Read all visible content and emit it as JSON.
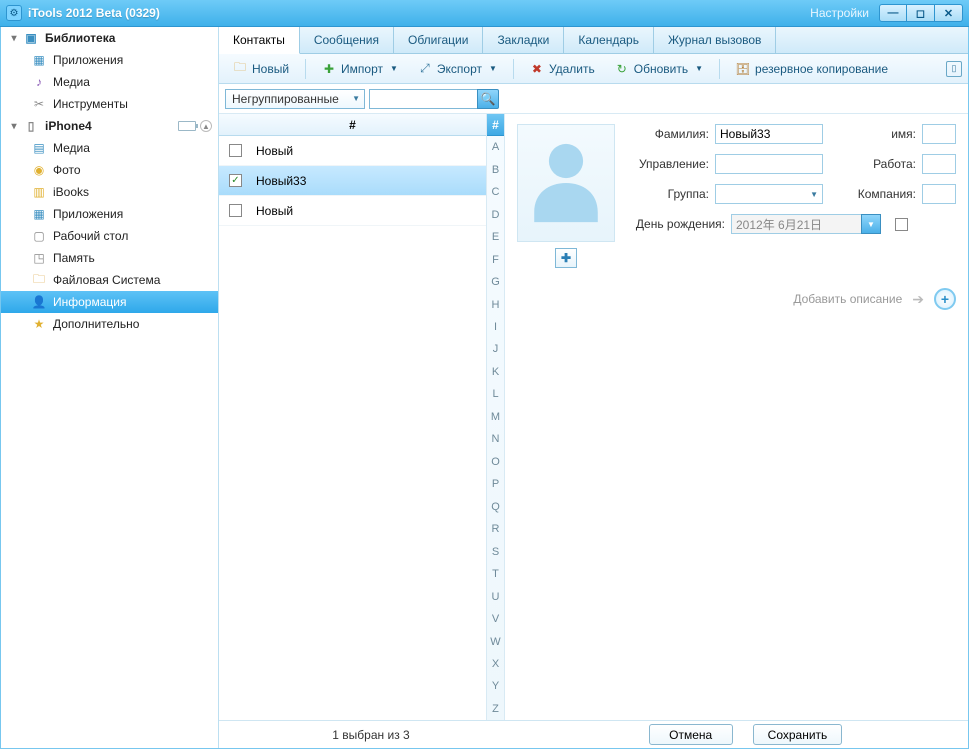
{
  "window": {
    "title": "iTools 2012 Beta (0329)",
    "settings": "Настройки"
  },
  "sidebar": {
    "library": "Библиотека",
    "lib_items": [
      "Приложения",
      "Медиа",
      "Инструменты"
    ],
    "device": "iPhone4",
    "dev_items": [
      "Медиа",
      "Фото",
      "iBooks",
      "Приложения",
      "Рабочий стол",
      "Память",
      "Файловая Система",
      "Информация",
      "Дополнительно"
    ],
    "selected_dev_index": 7
  },
  "tabs": {
    "items": [
      "Контакты",
      "Сообщения",
      "Облигации",
      "Закладки",
      "Календарь",
      "Журнал вызовов"
    ],
    "active": 0
  },
  "toolbar": {
    "new": "Новый",
    "import": "Импорт",
    "export": "Экспорт",
    "delete": "Удалить",
    "refresh": "Обновить",
    "backup": "резервное копирование"
  },
  "filter": {
    "group": "Негруппированные",
    "search": ""
  },
  "list": {
    "header": "#",
    "rows": [
      {
        "checked": false,
        "name": "Новый"
      },
      {
        "checked": true,
        "name": "Новый33"
      },
      {
        "checked": false,
        "name": "Новый"
      }
    ],
    "selected_index": 1,
    "az_header": "#",
    "az": [
      "A",
      "B",
      "C",
      "D",
      "E",
      "F",
      "G",
      "H",
      "I",
      "J",
      "K",
      "L",
      "M",
      "N",
      "O",
      "P",
      "Q",
      "R",
      "S",
      "T",
      "U",
      "V",
      "W",
      "X",
      "Y",
      "Z"
    ]
  },
  "detail": {
    "labels": {
      "surname": "Фамилия:",
      "name": "имя:",
      "dept": "Управление:",
      "job": "Работа:",
      "group": "Группа:",
      "company": "Компания:",
      "birthday": "День рождения:"
    },
    "values": {
      "surname": "Новый33",
      "name": "",
      "dept": "",
      "job": "",
      "group": "",
      "company": "",
      "birthday": "2012年 6月21日"
    },
    "add_desc": "Добавить описание"
  },
  "footer": {
    "status": "1 выбран из 3",
    "cancel": "Отмена",
    "save": "Сохранить"
  }
}
